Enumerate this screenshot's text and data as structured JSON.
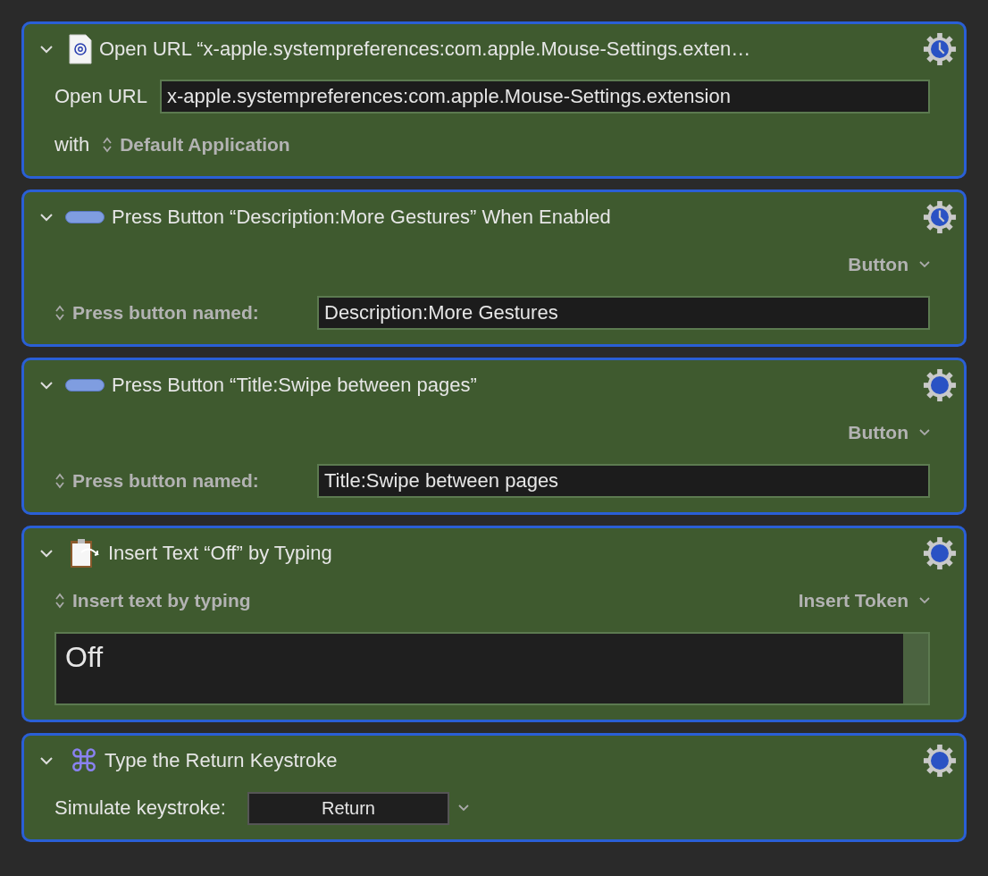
{
  "actions": [
    {
      "kind": "open_url",
      "title": "Open URL “x-apple.systempreferences:com.apple.Mouse-Settings.exten…",
      "timeout": true,
      "label": "Open URL",
      "url": "x-apple.systempreferences:com.apple.Mouse-Settings.extension",
      "with_label": "with",
      "application": "Default Application"
    },
    {
      "kind": "press_button",
      "title": "Press Button “Description:More Gestures” When Enabled",
      "timeout": true,
      "type_menu": "Button",
      "label": "Press button named:",
      "value": "Description:More Gestures"
    },
    {
      "kind": "press_button",
      "title": "Press Button “Title:Swipe between pages”",
      "timeout": false,
      "type_menu": "Button",
      "label": "Press button named:",
      "value": "Title:Swipe between pages"
    },
    {
      "kind": "insert_text",
      "title": "Insert Text “Off” by Typing",
      "timeout": false,
      "mode": "Insert text by typing",
      "token_menu": "Insert Token",
      "text": "Off"
    },
    {
      "kind": "keystroke",
      "title": "Type the Return Keystroke",
      "timeout": false,
      "icon_glyph": "⌘",
      "label": "Simulate keystroke:",
      "key": "Return"
    }
  ]
}
